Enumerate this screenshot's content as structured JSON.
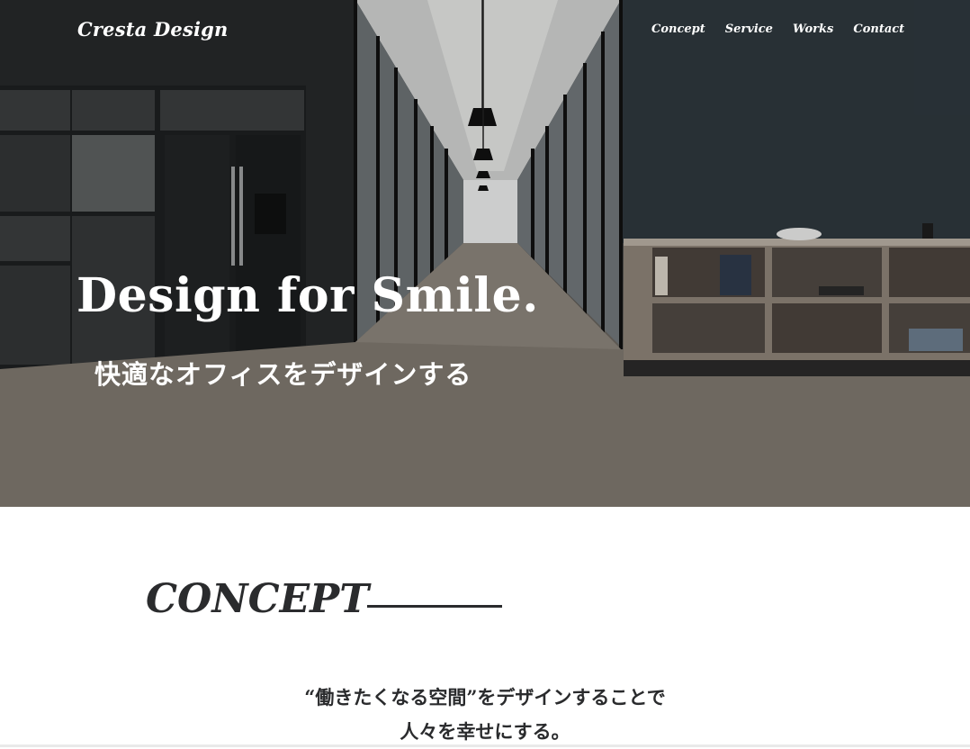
{
  "header": {
    "logo": "Cresta Design",
    "nav": [
      "Concept",
      "Service",
      "Works",
      "Contact"
    ]
  },
  "hero": {
    "title": "Design for Smile.",
    "subtitle": "快適なオフィスをデザインする"
  },
  "concept": {
    "heading": "CONCEPT",
    "lines": [
      "“働きたくなる空間”をデザインすることで",
      "人々を幸せにする。"
    ]
  },
  "colors": {
    "text_dark": "#2a2b2d",
    "text_light": "#ffffff",
    "background": "#ffffff"
  }
}
